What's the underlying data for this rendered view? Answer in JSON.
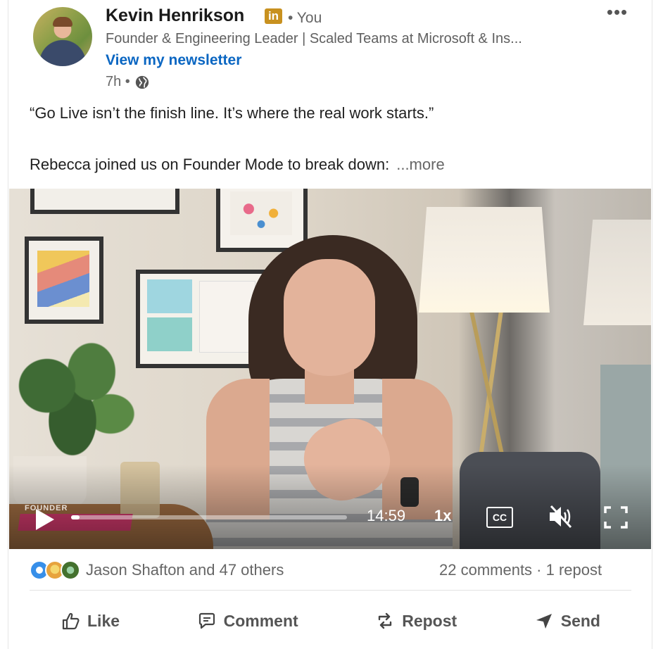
{
  "post": {
    "author": {
      "name": "Kevin Henrikson",
      "badge": "in",
      "relation": "• You",
      "headline": "Founder & Engineering Leader | Scaled Teams at Microsoft & Ins...",
      "newsletter_link": "View my newsletter",
      "time": "7h •"
    },
    "menu_label": "•••",
    "text": {
      "quote": "“Go Live isn’t the finish line. It’s where the real work starts.”",
      "paragraph": "Rebecca joined us on Founder Mode to break down:",
      "more": "...more"
    },
    "video": {
      "watermark": "FOUNDER",
      "time_remaining": "14:59",
      "speed": "1x",
      "cc_label": "CC",
      "progress": 0.03
    },
    "social": {
      "reactors": "Jason Shafton and 47 others",
      "counts": "22 comments · 1 repost",
      "reaction_icons": [
        "like-icon",
        "insightful-icon",
        "support-icon"
      ]
    },
    "actions": {
      "like": "Like",
      "comment": "Comment",
      "repost": "Repost",
      "send": "Send"
    }
  },
  "colors": {
    "link": "#0a66c2",
    "badge": "#c8911f",
    "text_secondary": "#666666"
  }
}
